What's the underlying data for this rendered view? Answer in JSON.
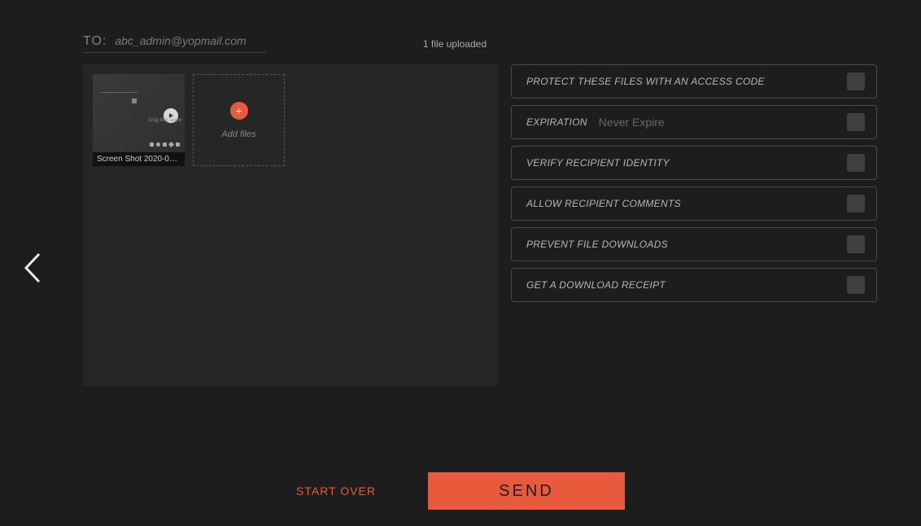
{
  "header": {
    "to_label": "TO:",
    "to_email": "abc_admin@yopmail.com",
    "upload_count": "1 file uploaded"
  },
  "files": {
    "thumb_filename": "Screen Shot 2020-02…",
    "thumb_dragtext": "Drag files anyw",
    "add_label": "Add files"
  },
  "options": [
    {
      "label": "PROTECT THESE FILES WITH AN ACCESS CODE"
    },
    {
      "label": "EXPIRATION",
      "value": "Never Expire"
    },
    {
      "label": "VERIFY RECIPIENT IDENTITY"
    },
    {
      "label": "ALLOW RECIPIENT COMMENTS"
    },
    {
      "label": "PREVENT FILE DOWNLOADS"
    },
    {
      "label": "GET A DOWNLOAD RECEIPT"
    }
  ],
  "footer": {
    "start_over": "START OVER",
    "send": "SEND"
  }
}
